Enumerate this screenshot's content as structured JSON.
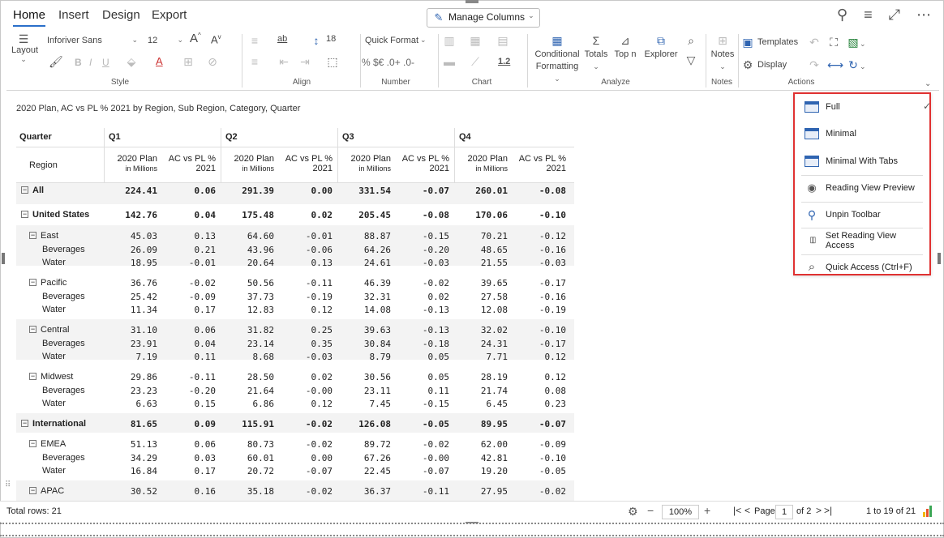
{
  "tabs": [
    "Home",
    "Insert",
    "Design",
    "Export"
  ],
  "manage_columns": "Manage Columns",
  "ribbon": {
    "layout_label": "Layout",
    "font_name": "Inforiver Sans",
    "font_size": "12",
    "line_height": "18",
    "quick_format": "Quick Format",
    "conditional_formatting_1": "Conditional",
    "conditional_formatting_2": "Formatting",
    "totals": "Totals",
    "topn": "Top n",
    "explorer": "Explorer",
    "notes": "Notes",
    "templates": "Templates",
    "display": "Display",
    "chart_scale": "1.2",
    "num_glyphs": "% $€ .0+ .0-",
    "groups": {
      "style": "Style",
      "align": "Align",
      "number": "Number",
      "chart": "Chart",
      "analyze": "Analyze",
      "notes": "Notes",
      "actions": "Actions"
    }
  },
  "report_title": "2020 Plan, AC vs PL % 2021 by Region, Sub Region, Category, Quarter",
  "table": {
    "quarter_label": "Quarter",
    "region_label": "Region",
    "quarters": [
      "Q1",
      "Q2",
      "Q3",
      "Q4"
    ],
    "col_headers": [
      {
        "l1": "2020 Plan",
        "l2": "in Millions"
      },
      {
        "l1": "AC vs PL %",
        "l2": "2021"
      }
    ],
    "rows": [
      {
        "label": "All",
        "level": 0,
        "bold": true,
        "expand": true,
        "vals": [
          "224.41",
          "0.06",
          "291.39",
          "0.00",
          "331.54",
          "-0.07",
          "260.01",
          "-0.08"
        ]
      },
      {
        "label": "United States",
        "level": 0,
        "bold": true,
        "expand": true,
        "vals": [
          "142.76",
          "0.04",
          "175.48",
          "0.02",
          "205.45",
          "-0.08",
          "170.06",
          "-0.10"
        ]
      },
      {
        "label": "East",
        "level": 1,
        "bold": false,
        "expand": true,
        "vals": [
          "45.03",
          "0.13",
          "64.60",
          "-0.01",
          "88.87",
          "-0.15",
          "70.21",
          "-0.12"
        ]
      },
      {
        "label": "Beverages",
        "level": 2,
        "bold": false,
        "expand": false,
        "vals": [
          "26.09",
          "0.21",
          "43.96",
          "-0.06",
          "64.26",
          "-0.20",
          "48.65",
          "-0.16"
        ]
      },
      {
        "label": "Water",
        "level": 2,
        "bold": false,
        "expand": false,
        "vals": [
          "18.95",
          "-0.01",
          "20.64",
          "0.13",
          "24.61",
          "-0.03",
          "21.55",
          "-0.03"
        ]
      },
      {
        "label": "Pacific",
        "level": 1,
        "bold": false,
        "expand": true,
        "vals": [
          "36.76",
          "-0.02",
          "50.56",
          "-0.11",
          "46.39",
          "-0.02",
          "39.65",
          "-0.17"
        ]
      },
      {
        "label": "Beverages",
        "level": 2,
        "bold": false,
        "expand": false,
        "vals": [
          "25.42",
          "-0.09",
          "37.73",
          "-0.19",
          "32.31",
          "0.02",
          "27.58",
          "-0.16"
        ]
      },
      {
        "label": "Water",
        "level": 2,
        "bold": false,
        "expand": false,
        "vals": [
          "11.34",
          "0.17",
          "12.83",
          "0.12",
          "14.08",
          "-0.13",
          "12.08",
          "-0.19"
        ]
      },
      {
        "label": "Central",
        "level": 1,
        "bold": false,
        "expand": true,
        "vals": [
          "31.10",
          "0.06",
          "31.82",
          "0.25",
          "39.63",
          "-0.13",
          "32.02",
          "-0.10"
        ]
      },
      {
        "label": "Beverages",
        "level": 2,
        "bold": false,
        "expand": false,
        "vals": [
          "23.91",
          "0.04",
          "23.14",
          "0.35",
          "30.84",
          "-0.18",
          "24.31",
          "-0.17"
        ]
      },
      {
        "label": "Water",
        "level": 2,
        "bold": false,
        "expand": false,
        "vals": [
          "7.19",
          "0.11",
          "8.68",
          "-0.03",
          "8.79",
          "0.05",
          "7.71",
          "0.12"
        ]
      },
      {
        "label": "Midwest",
        "level": 1,
        "bold": false,
        "expand": true,
        "vals": [
          "29.86",
          "-0.11",
          "28.50",
          "0.02",
          "30.56",
          "0.05",
          "28.19",
          "0.12"
        ]
      },
      {
        "label": "Beverages",
        "level": 2,
        "bold": false,
        "expand": false,
        "vals": [
          "23.23",
          "-0.20",
          "21.64",
          "-0.00",
          "23.11",
          "0.11",
          "21.74",
          "0.08"
        ]
      },
      {
        "label": "Water",
        "level": 2,
        "bold": false,
        "expand": false,
        "vals": [
          "6.63",
          "0.15",
          "6.86",
          "0.12",
          "7.45",
          "-0.15",
          "6.45",
          "0.23"
        ]
      },
      {
        "label": "International",
        "level": 0,
        "bold": true,
        "expand": true,
        "vals": [
          "81.65",
          "0.09",
          "115.91",
          "-0.02",
          "126.08",
          "-0.05",
          "89.95",
          "-0.07"
        ]
      },
      {
        "label": "EMEA",
        "level": 1,
        "bold": false,
        "expand": true,
        "vals": [
          "51.13",
          "0.06",
          "80.73",
          "-0.02",
          "89.72",
          "-0.02",
          "62.00",
          "-0.09"
        ]
      },
      {
        "label": "Beverages",
        "level": 2,
        "bold": false,
        "expand": false,
        "vals": [
          "34.29",
          "0.03",
          "60.01",
          "0.00",
          "67.26",
          "-0.00",
          "42.81",
          "-0.10"
        ]
      },
      {
        "label": "Water",
        "level": 2,
        "bold": false,
        "expand": false,
        "vals": [
          "16.84",
          "0.17",
          "20.72",
          "-0.07",
          "22.45",
          "-0.07",
          "19.20",
          "-0.05"
        ]
      },
      {
        "label": "APAC",
        "level": 1,
        "bold": false,
        "expand": true,
        "vals": [
          "30.52",
          "0.16",
          "35.18",
          "-0.02",
          "36.37",
          "-0.11",
          "27.95",
          "-0.02"
        ]
      }
    ]
  },
  "status": {
    "total_rows": "Total rows: 21",
    "zoom": "100%",
    "page_label": "Page",
    "page_num": "1",
    "page_of": "of 2",
    "range": "1 to 19 of 21"
  },
  "display_menu": {
    "items": [
      "Full",
      "Minimal",
      "Minimal With Tabs",
      "Reading View Preview",
      "Unpin Toolbar",
      "Set Reading View Access",
      "Quick Access (Ctrl+F)"
    ],
    "checked": "Full"
  },
  "colors": {
    "accent": "#2a6fc9",
    "highlight_border": "#e03131",
    "row_shade": "#f3f3f3"
  }
}
